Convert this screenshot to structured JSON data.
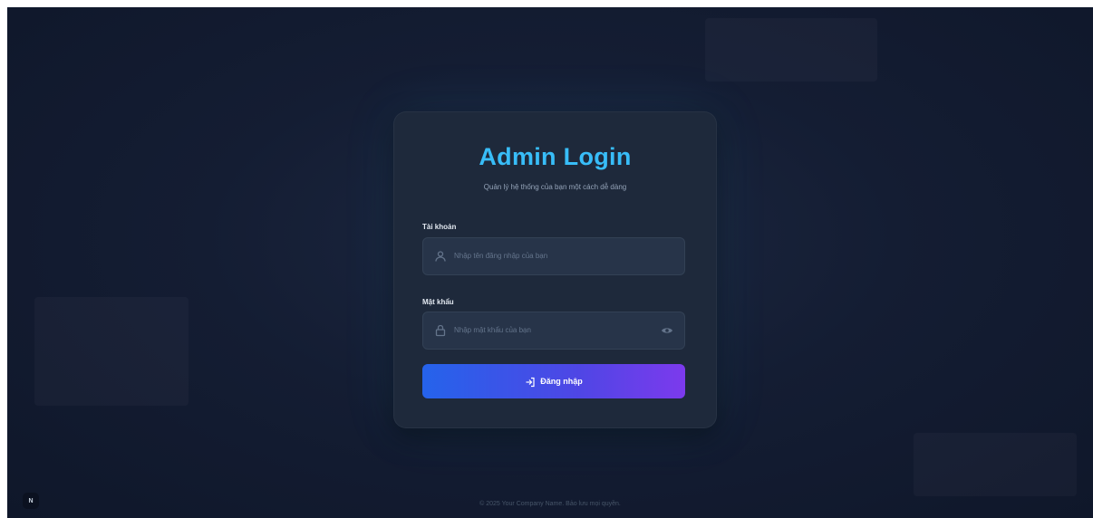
{
  "login": {
    "title": "Admin Login",
    "subtitle": "Quản lý hệ thống của bạn một cách dễ dàng",
    "username_label": "Tài khoản",
    "username_placeholder": "Nhập tên đăng nhập của bạn",
    "password_label": "Mật khẩu",
    "password_placeholder": "Nhập mật khẩu của bạn",
    "submit_label": "Đăng nhập"
  },
  "footer": {
    "copyright": "© 2025 Your Company Name. Bảo lưu mọi quyền."
  },
  "lang_toggle": {
    "label": "N"
  },
  "icons": {
    "user": "user-icon",
    "lock": "lock-icon",
    "eye": "eye-icon",
    "login": "login-icon"
  },
  "colors": {
    "background": "#0f172a",
    "card": "#1e293b",
    "title": "#38bdf8",
    "button_start": "#2563eb",
    "button_end": "#7c3aed"
  }
}
